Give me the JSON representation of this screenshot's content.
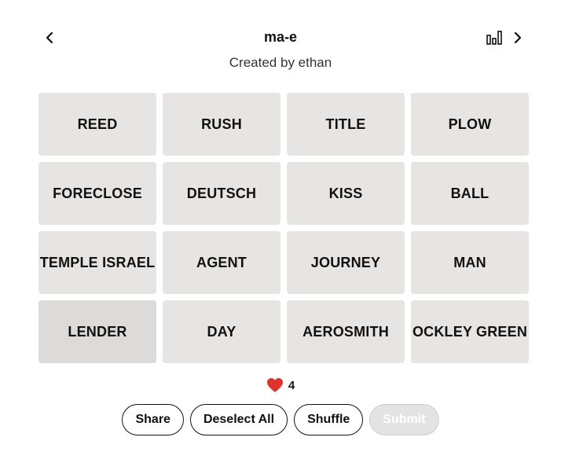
{
  "header": {
    "title": "ma-e",
    "subtitle": "Created by ethan"
  },
  "tiles": [
    {
      "label": "REED"
    },
    {
      "label": "RUSH"
    },
    {
      "label": "TITLE"
    },
    {
      "label": "PLOW"
    },
    {
      "label": "FORECLOSE"
    },
    {
      "label": "DEUTSCH"
    },
    {
      "label": "KISS"
    },
    {
      "label": "BALL"
    },
    {
      "label": "TEMPLE ISRAEL"
    },
    {
      "label": "AGENT"
    },
    {
      "label": "JOURNEY"
    },
    {
      "label": "MAN"
    },
    {
      "label": "LENDER"
    },
    {
      "label": "DAY"
    },
    {
      "label": "AEROSMITH"
    },
    {
      "label": "OCKLEY GREEN"
    }
  ],
  "lives": {
    "count": "4",
    "icon": "heart-icon",
    "color": "#e0322a"
  },
  "controls": {
    "share_label": "Share",
    "deselect_label": "Deselect All",
    "shuffle_label": "Shuffle",
    "submit_label": "Submit"
  },
  "colors": {
    "tile_bg": "#e6e5e3",
    "tile_hover_bg": "#dcdbd9",
    "text": "#111111"
  }
}
